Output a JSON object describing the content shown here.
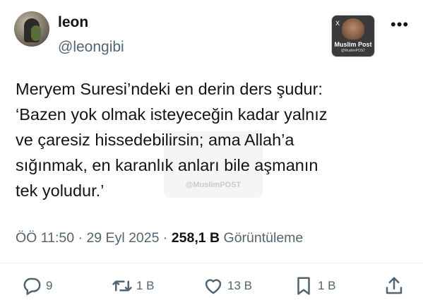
{
  "author": {
    "name": "leon",
    "handle": "@leongibi"
  },
  "brand_badge": {
    "title": "Muslim Post",
    "subtitle": "@MuslimPOST",
    "x_mark": "X"
  },
  "more_icon": "•••",
  "tweet": {
    "lines": [
      "Meryem Suresi’ndeki en derin ders şudur:",
      "‘Bazen yok olmak isteyeceğin kadar yalnız",
      "ve çaresiz hissedebilirsin; ama Allah’a",
      "sığınmak, en karanlık anları bile aşmanın",
      "tek yoludur.’"
    ]
  },
  "watermark": "@MuslimPOST",
  "meta": {
    "time": "ÖÖ 11:50",
    "sep1": " · ",
    "date": "29 Eyl 2025",
    "sep2": " · ",
    "views": "258,1 B",
    "views_label": " Görüntüleme"
  },
  "actions": {
    "reply": {
      "icon": "reply-icon",
      "count": "9"
    },
    "retweet": {
      "icon": "retweet-icon",
      "count": "1 B"
    },
    "like": {
      "icon": "heart-icon",
      "count": "13 B"
    },
    "bookmark": {
      "icon": "bookmark-icon",
      "count": "1 B"
    },
    "share": {
      "icon": "share-icon"
    }
  },
  "colors": {
    "text": "#0f1419",
    "muted": "#536471"
  }
}
